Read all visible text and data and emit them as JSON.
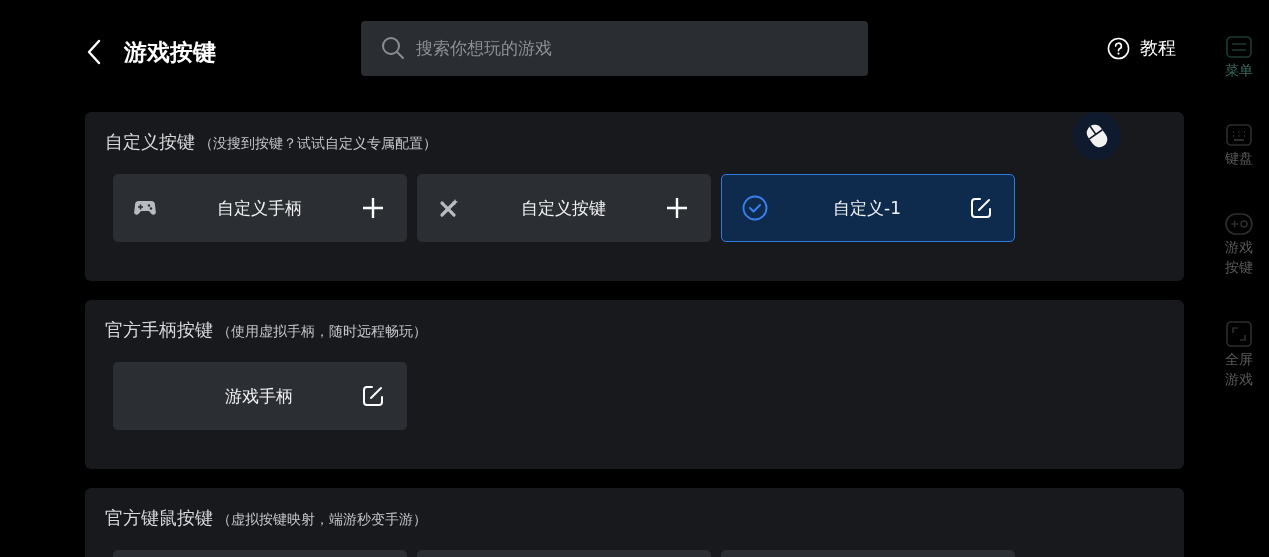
{
  "header": {
    "title": "游戏按键",
    "search": {
      "placeholder": "搜索你想玩的游戏"
    },
    "help": "教程"
  },
  "sections": [
    {
      "title": "自定义按键",
      "note": "（没搜到按键？试试自定义专属配置）",
      "cards": [
        {
          "kind": "add",
          "label": "自定义手柄",
          "selected": false
        },
        {
          "kind": "add",
          "label": "自定义按键",
          "selected": false
        },
        {
          "kind": "edit",
          "label": "自定义-1",
          "selected": true
        }
      ]
    },
    {
      "title": "官方手柄按键",
      "note": "（使用虚拟手柄，随时远程畅玩）",
      "cards": [
        {
          "kind": "edit",
          "label": "游戏手柄",
          "selected": false
        }
      ]
    },
    {
      "title": "官方键鼠按键",
      "note": "（虚拟按键映射，端游秒变手游）",
      "cards": [
        {
          "kind": "empty"
        },
        {
          "kind": "empty"
        },
        {
          "kind": "empty"
        }
      ]
    }
  ],
  "sidebar": {
    "items": [
      {
        "label": "菜单",
        "selected": true
      },
      {
        "label": "键盘",
        "selected": false
      },
      {
        "label": "游戏按键",
        "selected": false
      },
      {
        "label": "全屏游戏",
        "selected": false
      }
    ]
  }
}
